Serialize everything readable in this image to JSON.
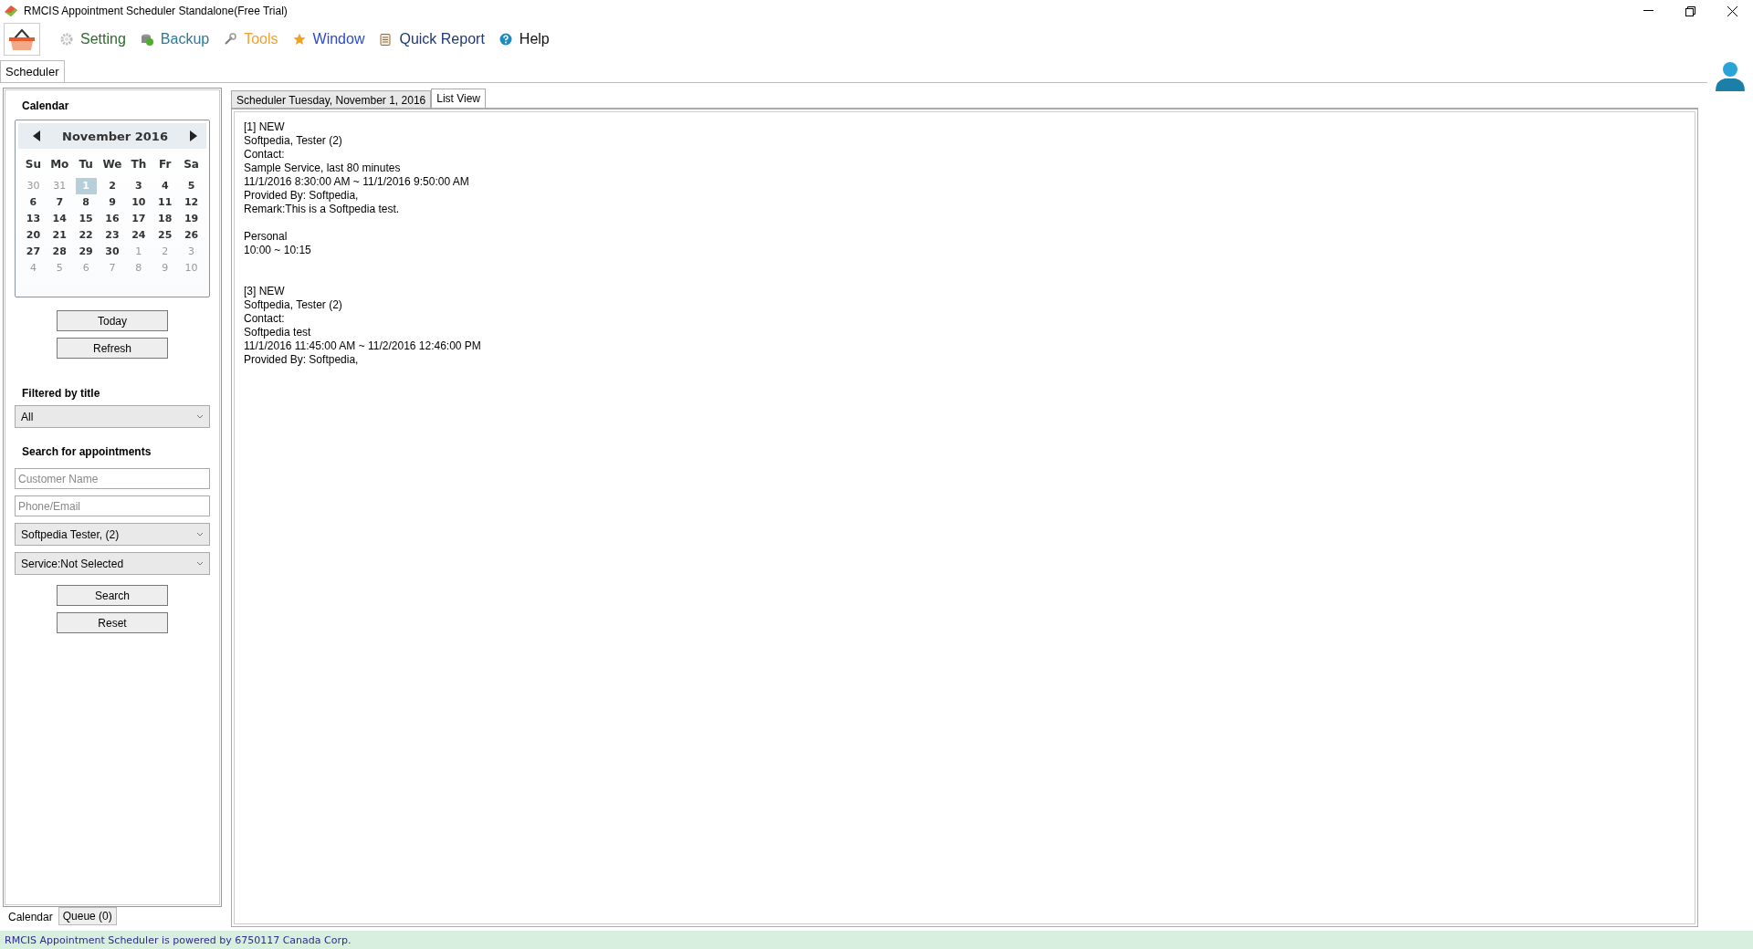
{
  "window": {
    "title": "RMCIS Appointment Scheduler Standalone(Free Trial)"
  },
  "menu": [
    {
      "label": "Setting",
      "color": "#2e6b2e"
    },
    {
      "label": "Backup",
      "color": "#2a7a9a"
    },
    {
      "label": "Tools",
      "color": "#f0a030"
    },
    {
      "label": "Window",
      "color": "#2a4ad0"
    },
    {
      "label": "Quick Report",
      "color": "#1e3a70"
    },
    {
      "label": "Help",
      "color": "#111111"
    }
  ],
  "main_tabs": [
    {
      "label": "Scheduler",
      "selected": true
    }
  ],
  "sidebar": {
    "calendar_title": "Calendar",
    "calendar": {
      "month": "November 2016",
      "weekdays": [
        "Su",
        "Mo",
        "Tu",
        "We",
        "Th",
        "Fr",
        "Sa"
      ],
      "days": [
        {
          "label": "30",
          "muted": true,
          "selected": false
        },
        {
          "label": "31",
          "muted": true,
          "selected": false
        },
        {
          "label": "1",
          "muted": false,
          "selected": true
        },
        {
          "label": "2",
          "muted": false,
          "selected": false
        },
        {
          "label": "3",
          "muted": false,
          "selected": false
        },
        {
          "label": "4",
          "muted": false,
          "selected": false
        },
        {
          "label": "5",
          "muted": false,
          "selected": false
        },
        {
          "label": "6",
          "muted": false,
          "selected": false
        },
        {
          "label": "7",
          "muted": false,
          "selected": false
        },
        {
          "label": "8",
          "muted": false,
          "selected": false
        },
        {
          "label": "9",
          "muted": false,
          "selected": false
        },
        {
          "label": "10",
          "muted": false,
          "selected": false
        },
        {
          "label": "11",
          "muted": false,
          "selected": false
        },
        {
          "label": "12",
          "muted": false,
          "selected": false
        },
        {
          "label": "13",
          "muted": false,
          "selected": false
        },
        {
          "label": "14",
          "muted": false,
          "selected": false
        },
        {
          "label": "15",
          "muted": false,
          "selected": false
        },
        {
          "label": "16",
          "muted": false,
          "selected": false
        },
        {
          "label": "17",
          "muted": false,
          "selected": false
        },
        {
          "label": "18",
          "muted": false,
          "selected": false
        },
        {
          "label": "19",
          "muted": false,
          "selected": false
        },
        {
          "label": "20",
          "muted": false,
          "selected": false
        },
        {
          "label": "21",
          "muted": false,
          "selected": false
        },
        {
          "label": "22",
          "muted": false,
          "selected": false
        },
        {
          "label": "23",
          "muted": false,
          "selected": false
        },
        {
          "label": "24",
          "muted": false,
          "selected": false
        },
        {
          "label": "25",
          "muted": false,
          "selected": false
        },
        {
          "label": "26",
          "muted": false,
          "selected": false
        },
        {
          "label": "27",
          "muted": false,
          "selected": false
        },
        {
          "label": "28",
          "muted": false,
          "selected": false
        },
        {
          "label": "29",
          "muted": false,
          "selected": false
        },
        {
          "label": "30",
          "muted": false,
          "selected": false
        },
        {
          "label": "1",
          "muted": true,
          "selected": false
        },
        {
          "label": "2",
          "muted": true,
          "selected": false
        },
        {
          "label": "3",
          "muted": true,
          "selected": false
        },
        {
          "label": "4",
          "muted": true,
          "selected": false
        },
        {
          "label": "5",
          "muted": true,
          "selected": false
        },
        {
          "label": "6",
          "muted": true,
          "selected": false
        },
        {
          "label": "7",
          "muted": true,
          "selected": false
        },
        {
          "label": "8",
          "muted": true,
          "selected": false
        },
        {
          "label": "9",
          "muted": true,
          "selected": false
        },
        {
          "label": "10",
          "muted": true,
          "selected": false
        }
      ]
    },
    "calendar_buttons": [
      "Today",
      "Refresh"
    ],
    "filter_title": "Filtered by title",
    "filter": {
      "value": "All"
    },
    "search_title": "Search for appointments",
    "fields": [
      {
        "kind": "input",
        "placeholder": "Customer Name"
      },
      {
        "kind": "input",
        "placeholder": "Phone/Email"
      },
      {
        "kind": "select",
        "value": "Softpedia Tester, (2)"
      },
      {
        "kind": "select",
        "value": "Service:Not Selected"
      }
    ],
    "search_buttons": [
      "Search",
      "Reset"
    ],
    "bottom_tabs": [
      {
        "label": "Calendar",
        "selected": true
      },
      {
        "label": "Queue (0)",
        "selected": false
      }
    ]
  },
  "content": {
    "tabs": [
      {
        "label": "Scheduler Tuesday, November 1, 2016",
        "selected": false
      },
      {
        "label": "List View",
        "selected": true
      }
    ],
    "blocks": [
      {
        "kind": "appointment",
        "lines": [
          "[1] NEW",
          "Softpedia, Tester (2)",
          "Contact:",
          "Sample Service, last 80 minutes",
          "11/1/2016 8:30:00 AM ~ 11/1/2016 9:50:00 AM",
          "Provided By: Softpedia,",
          "Remark:This is a Softpedia test."
        ]
      },
      {
        "kind": "personal",
        "lines": [
          "Personal",
          "10:00 ~ 10:15"
        ]
      },
      {
        "kind": "appointment",
        "lines": [
          "[3] NEW",
          "Softpedia, Tester (2)",
          "Contact:",
          "Softpedia test",
          "11/1/2016 11:45:00 AM ~ 11/2/2016 12:46:00 PM",
          "Provided By: Softpedia,"
        ]
      }
    ]
  },
  "status_bar": "RMCIS Appointment Scheduler is powered by 6750117 Canada Corp."
}
